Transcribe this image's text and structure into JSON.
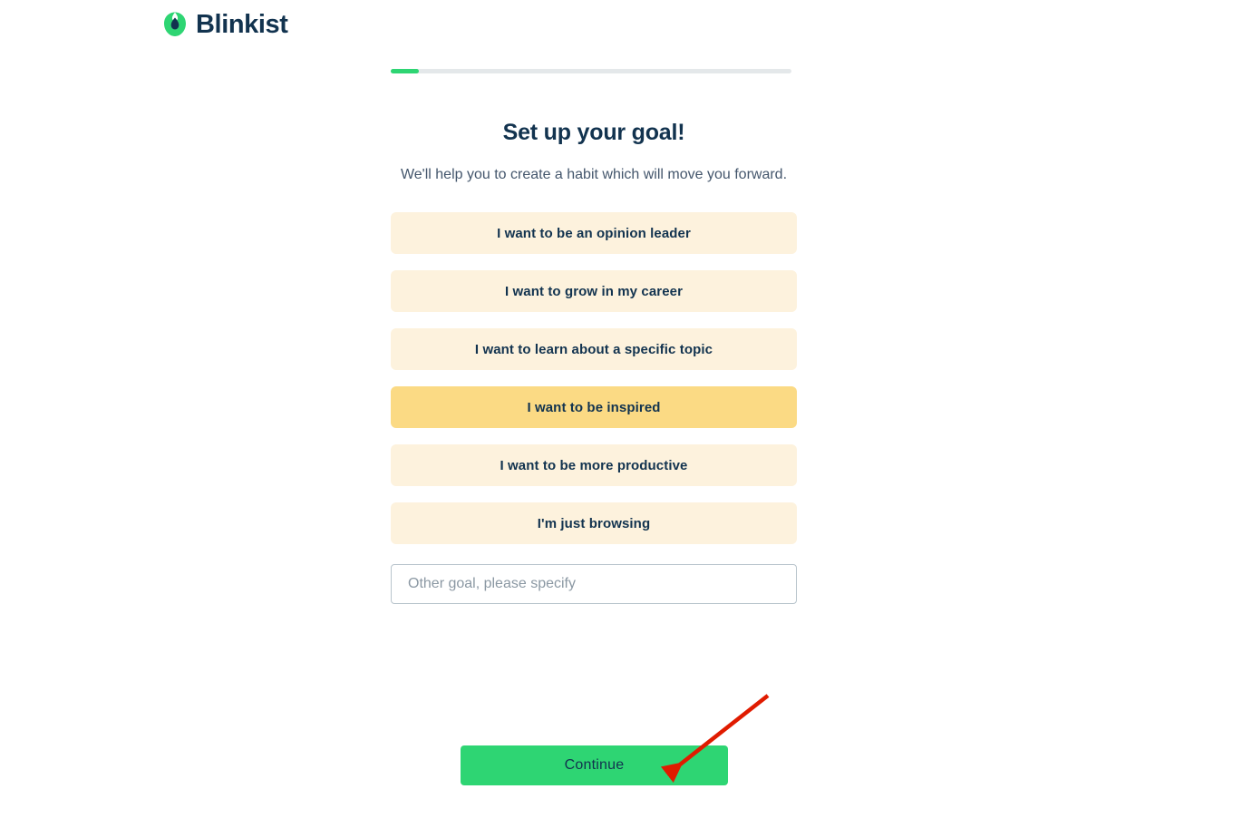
{
  "brand": {
    "name": "Blinkist",
    "logo_icon": "blinkist-droplet-icon",
    "logo_green": "#2ed573",
    "logo_navy": "#12334f"
  },
  "progress": {
    "percent": 7,
    "fill_color": "#2ed573",
    "track_color": "#e4e8ea"
  },
  "main": {
    "title": "Set up your goal!",
    "subtitle": "We'll help you to create a habit which will move you forward.",
    "options": [
      {
        "label": "I want to be an opinion leader",
        "selected": false
      },
      {
        "label": "I want to grow in my career",
        "selected": false
      },
      {
        "label": "I want to learn about a specific topic",
        "selected": false
      },
      {
        "label": "I want to be inspired",
        "selected": true
      },
      {
        "label": "I want to be more productive",
        "selected": false
      },
      {
        "label": "I'm just browsing",
        "selected": false
      }
    ],
    "other_goal": {
      "value": "",
      "placeholder": "Other goal, please specify"
    },
    "option_colors": {
      "unselected": "#fdf2dd",
      "selected": "#fbda84",
      "text": "#12334f"
    }
  },
  "footer": {
    "continue_label": "Continue",
    "continue_color": "#2ed573"
  },
  "annotation": {
    "arrow_icon": "red-pointer-arrow-icon",
    "color": "#e01b00"
  }
}
